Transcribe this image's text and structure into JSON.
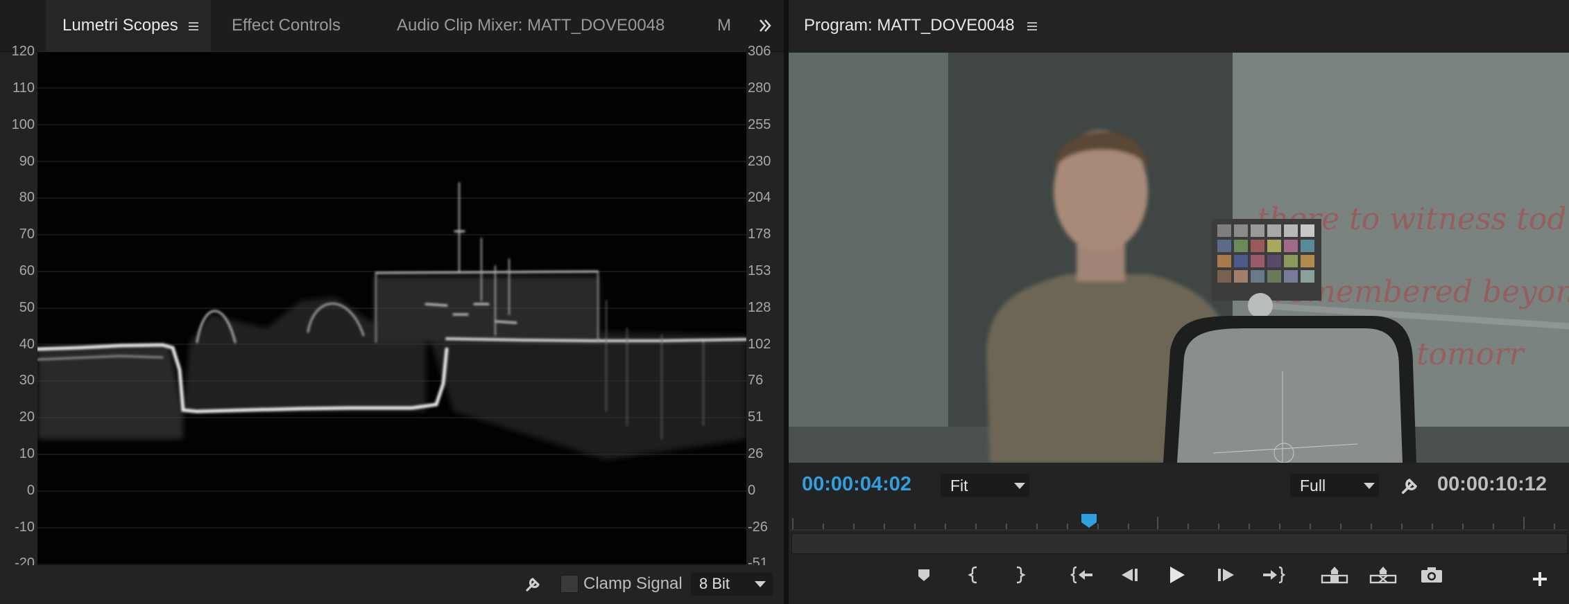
{
  "left_panel": {
    "tabs": [
      {
        "label": "Lumetri Scopes",
        "active": true
      },
      {
        "label": "Effect Controls",
        "active": false
      },
      {
        "label": "Audio Clip Mixer: MATT_DOVE0048",
        "active": false
      },
      {
        "label": "M",
        "active": false
      }
    ],
    "overflow_icon": "double-chevron-right-icon",
    "scope": {
      "type": "luma-waveform",
      "ire_axis": [
        "120",
        "110",
        "100",
        "90",
        "80",
        "70",
        "60",
        "50",
        "40",
        "30",
        "20",
        "10",
        "0",
        "-10",
        "-20"
      ],
      "code_axis": [
        "306",
        "280",
        "255",
        "230",
        "204",
        "178",
        "153",
        "128",
        "102",
        "76",
        "51",
        "26",
        "0",
        "-26",
        "-51"
      ]
    },
    "footer": {
      "settings_icon": "wrench-icon",
      "clamp_label": "Clamp Signal",
      "clamp_checked": false,
      "bit_depth": "8 Bit"
    }
  },
  "program_monitor": {
    "title": "Program: MATT_DOVE0048",
    "playhead_timecode": "00:00:04:02",
    "zoom": "Fit",
    "resolution": "Full",
    "settings_icon": "wrench-icon",
    "duration_timecode": "00:00:10:12",
    "wall_text": [
      "there to witness tod",
      "remembered beyond",
      "tomorr"
    ],
    "accent_color": "#2f9fe0",
    "controls": [
      {
        "name": "add-marker-button",
        "icon": "marker-icon"
      },
      {
        "name": "mark-in-button",
        "icon": "mark-in-icon"
      },
      {
        "name": "mark-out-button",
        "icon": "mark-out-icon"
      },
      {
        "name": "go-to-in-button",
        "icon": "go-to-in-icon"
      },
      {
        "name": "step-back-button",
        "icon": "step-back-icon"
      },
      {
        "name": "play-button",
        "icon": "play-icon"
      },
      {
        "name": "step-forward-button",
        "icon": "step-forward-icon"
      },
      {
        "name": "go-to-out-button",
        "icon": "go-to-out-icon"
      },
      {
        "name": "lift-button",
        "icon": "lift-icon"
      },
      {
        "name": "extract-button",
        "icon": "extract-icon"
      },
      {
        "name": "export-frame-button",
        "icon": "camera-icon"
      },
      {
        "name": "button-editor-button",
        "icon": "plus-icon"
      }
    ]
  }
}
